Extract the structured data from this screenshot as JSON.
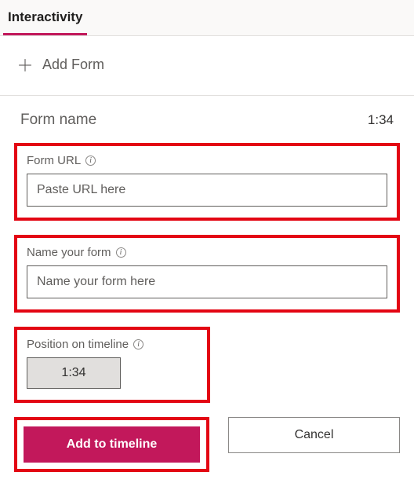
{
  "tab": {
    "label": "Interactivity"
  },
  "addFormRow": {
    "label": "Add Form"
  },
  "formHeader": {
    "title": "Form name",
    "time": "1:34"
  },
  "formUrl": {
    "label": "Form URL",
    "placeholder": "Paste URL here",
    "value": ""
  },
  "formName": {
    "label": "Name your form",
    "placeholder": "Name your form here",
    "value": ""
  },
  "position": {
    "label": "Position on timeline",
    "value": "1:34"
  },
  "buttons": {
    "primary": "Add to timeline",
    "secondary": "Cancel"
  }
}
